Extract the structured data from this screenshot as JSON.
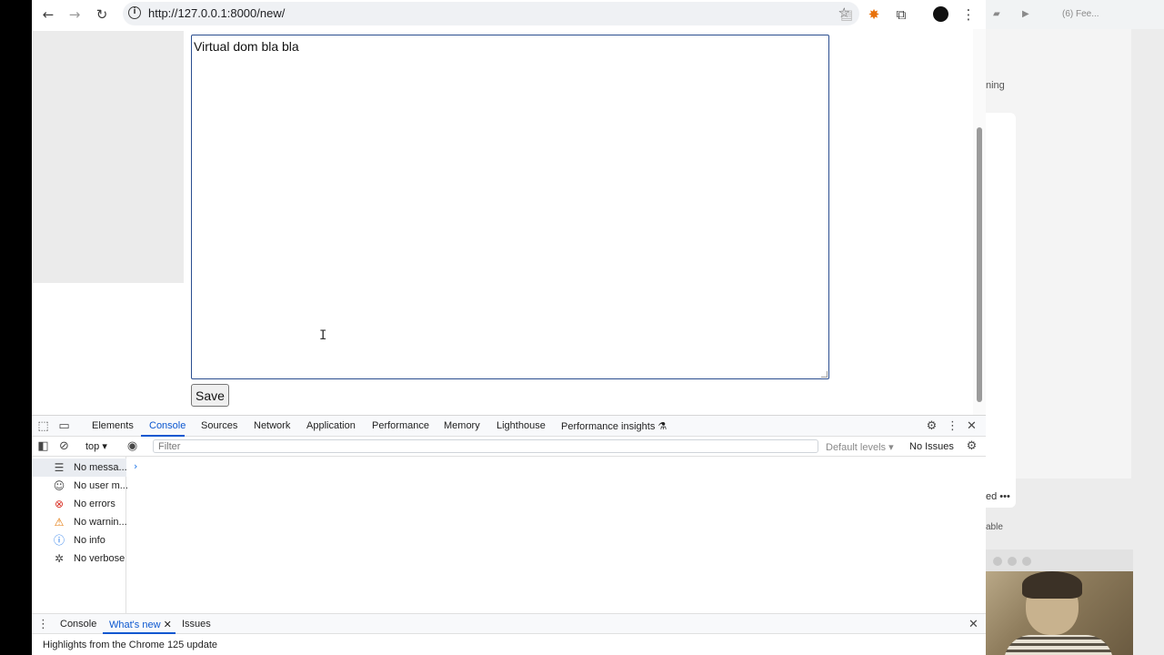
{
  "browser": {
    "url": "http://127.0.0.1:8000/new/"
  },
  "page": {
    "textarea_value": "Virtual dom bla bla",
    "save_label": "Save"
  },
  "devtools": {
    "tabs": [
      "Elements",
      "Console",
      "Sources",
      "Network",
      "Application",
      "Performance",
      "Memory",
      "Lighthouse",
      "Performance insights"
    ],
    "active_tab": "Console",
    "context": "top",
    "filter_placeholder": "Filter",
    "default_levels": "Default levels",
    "issues": "No Issues",
    "sidebar": [
      {
        "label": "No messa...",
        "icon": "list-icon"
      },
      {
        "label": "No user m...",
        "icon": "user-icon"
      },
      {
        "label": "No errors",
        "icon": "error-icon"
      },
      {
        "label": "No warnin...",
        "icon": "warning-icon"
      },
      {
        "label": "No info",
        "icon": "info-icon"
      },
      {
        "label": "No verbose",
        "icon": "bug-icon"
      }
    ],
    "drawer_tabs": [
      "Console",
      "What's new",
      "Issues"
    ],
    "drawer_active": "What's new",
    "whats_new_text": "Highlights from the Chrome 125 update"
  },
  "background": {
    "tab_text": "(6) Fee...",
    "text_ning": "ning",
    "text_ed": "ed",
    "text_able": "able"
  },
  "colors": {
    "accent": "#0b57d0",
    "editor_border": "#2a4d8f"
  }
}
